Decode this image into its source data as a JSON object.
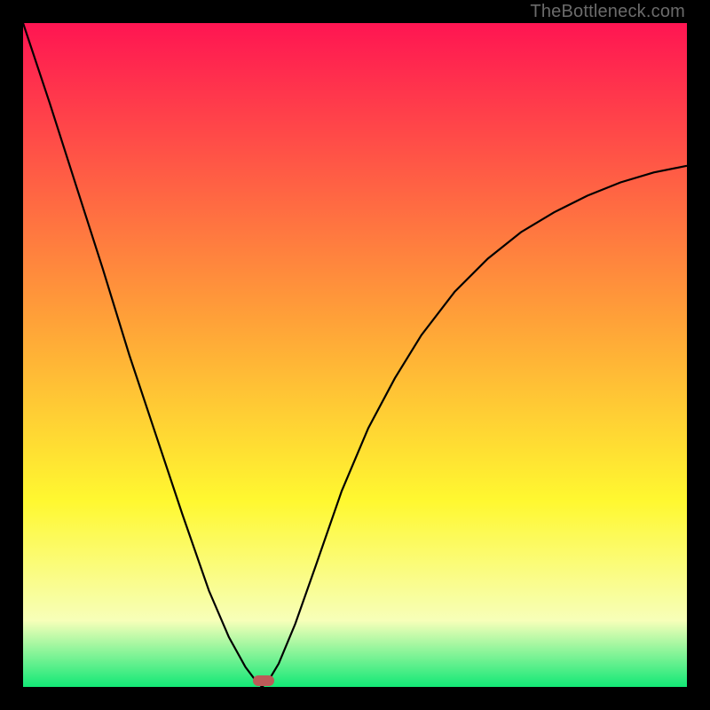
{
  "watermark": "TheBottleneck.com",
  "colors": {
    "gradient_top": "#ff1552",
    "gradient_mid_orange": "#ffa238",
    "gradient_yellow": "#fff830",
    "gradient_pale": "#f7ffb9",
    "gradient_green": "#12e876",
    "curve": "#000000",
    "marker": "#bb5b58",
    "frame": "#000000"
  },
  "marker": {
    "x_fraction": 0.362,
    "y_fraction": 0.998
  },
  "chart_data": {
    "type": "line",
    "title": "",
    "xlabel": "",
    "ylabel": "",
    "xlim": [
      0,
      1
    ],
    "ylim": [
      0,
      1
    ],
    "note": "Axes are implicit (no tick labels shown). x is normalized horizontal position across the plot area, y is normalized vertical position where 0 = top and 1 = bottom. Values estimated from pixel positions.",
    "series": [
      {
        "name": "bottleneck-curve",
        "x": [
          0.0,
          0.04,
          0.08,
          0.12,
          0.16,
          0.2,
          0.24,
          0.28,
          0.31,
          0.335,
          0.35,
          0.36,
          0.37,
          0.385,
          0.41,
          0.44,
          0.48,
          0.52,
          0.56,
          0.6,
          0.65,
          0.7,
          0.75,
          0.8,
          0.85,
          0.9,
          0.95,
          1.0
        ],
        "y": [
          0.0,
          0.12,
          0.245,
          0.37,
          0.5,
          0.62,
          0.74,
          0.855,
          0.925,
          0.97,
          0.99,
          1.0,
          0.99,
          0.965,
          0.905,
          0.82,
          0.705,
          0.61,
          0.535,
          0.47,
          0.405,
          0.355,
          0.315,
          0.285,
          0.26,
          0.24,
          0.225,
          0.215
        ]
      }
    ],
    "marker_point": {
      "x": 0.362,
      "y": 1.0
    },
    "background_gradient_stops": [
      {
        "pos": 0.0,
        "color": "#ff1552"
      },
      {
        "pos": 0.45,
        "color": "#ffa238"
      },
      {
        "pos": 0.72,
        "color": "#fff830"
      },
      {
        "pos": 0.9,
        "color": "#f7ffb9"
      },
      {
        "pos": 1.0,
        "color": "#12e876"
      }
    ]
  }
}
